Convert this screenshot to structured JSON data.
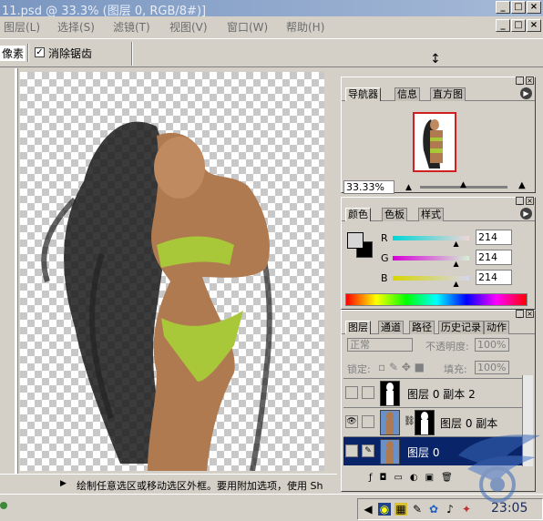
{
  "window": {
    "title": "11.psd @ 33.3% (图层 0, RGB/8#)]",
    "controls": [
      "_",
      "□",
      "×"
    ]
  },
  "menubar": {
    "items": [
      "图层(L)",
      "选择(S)",
      "滤镜(T)",
      "视图(V)",
      "窗口(W)",
      "帮助(H)"
    ],
    "controls": [
      "_",
      "□",
      "×"
    ]
  },
  "options": {
    "unit_suffix": "像素",
    "antialias_label": "消除锯齿",
    "antialias_checked": true
  },
  "status": {
    "hint": "绘制任意选区或移动选区外框。要用附加选项，使用 Sh"
  },
  "navigator": {
    "tabs": [
      "导航器",
      "信息",
      "直方图"
    ],
    "zoom": "33.33%"
  },
  "color": {
    "tabs": [
      "颜色",
      "色板",
      "样式"
    ],
    "channels": [
      {
        "label": "R",
        "value": "214",
        "slider_fraction": 0.84
      },
      {
        "label": "G",
        "value": "214",
        "slider_fraction": 0.84
      },
      {
        "label": "B",
        "value": "214",
        "slider_fraction": 0.84
      }
    ],
    "accent_r": "#20c0d0",
    "accent_g": "#e040c0",
    "accent_b": "#d8d020"
  },
  "layers": {
    "tabs": [
      "图层",
      "通道",
      "路径",
      "历史记录",
      "动作"
    ],
    "blend_mode": "正常",
    "opacity_label": "不透明度:",
    "opacity_value": "100%",
    "lock_label": "锁定:",
    "fill_label": "填充:",
    "fill_value": "100%",
    "rows": [
      {
        "name": "图层 0 副本 2",
        "visible": false,
        "selected": false
      },
      {
        "name": "图层 0 副本",
        "visible": true,
        "selected": false
      },
      {
        "name": "图层 0",
        "visible": false,
        "selected": true
      }
    ],
    "selection_color": "#0a246a"
  },
  "taskbar": {
    "clock": "23:05"
  }
}
